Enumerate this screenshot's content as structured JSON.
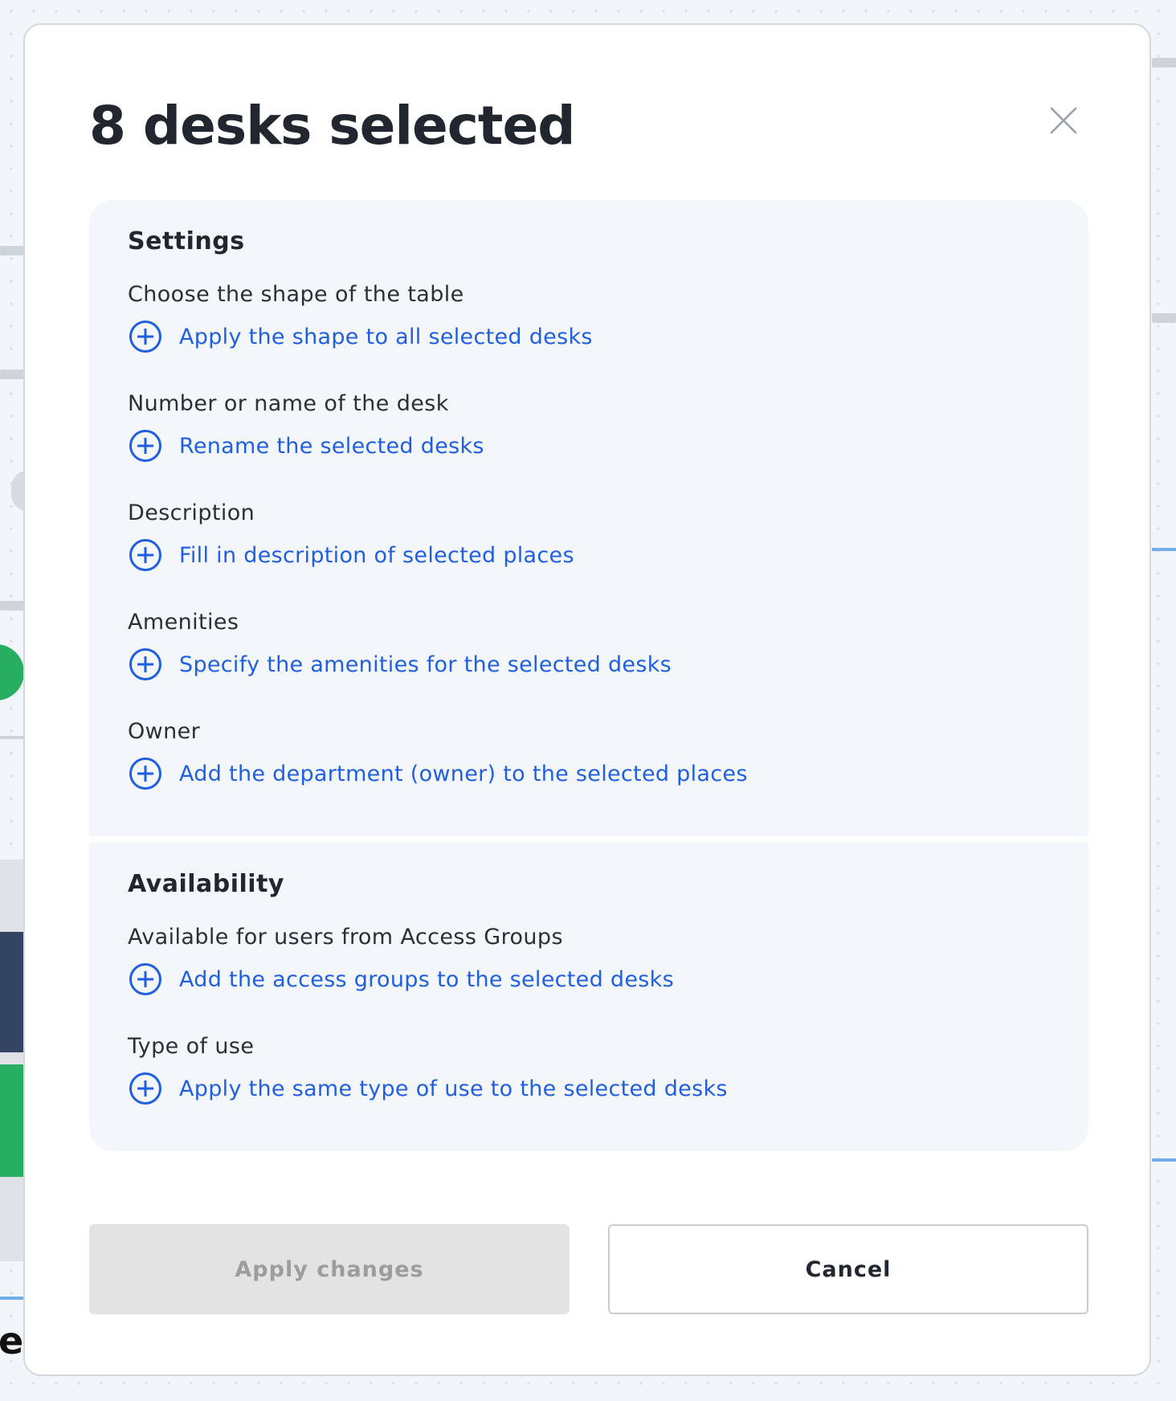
{
  "modal": {
    "title": "8 desks selected",
    "close_icon": "close-icon"
  },
  "settings": {
    "heading": "Settings",
    "fields": [
      {
        "label": "Choose the shape of the table",
        "action": "Apply the shape to all selected desks"
      },
      {
        "label": "Number or name of the desk",
        "action": "Rename the selected desks"
      },
      {
        "label": "Description",
        "action": "Fill in description of selected places"
      },
      {
        "label": "Amenities",
        "action": "Specify the amenities for the selected desks"
      },
      {
        "label": "Owner",
        "action": "Add the department (owner) to the selected places"
      }
    ]
  },
  "availability": {
    "heading": "Availability",
    "fields": [
      {
        "label": "Available for users from Access Groups",
        "action": "Add the access groups to the selected desks"
      },
      {
        "label": "Type of use",
        "action": "Apply the same type of use to the selected desks"
      }
    ]
  },
  "footer": {
    "apply_label": "Apply changes",
    "apply_disabled": true,
    "cancel_label": "Cancel"
  },
  "background": {
    "partial_letter": "e"
  },
  "colors": {
    "link": "#1f5fe0",
    "text": "#22262e",
    "panel_bg": "#f3f6fb",
    "disabled_bg": "#e3e3e3",
    "disabled_text": "#9d9d9d"
  },
  "icons": {
    "add": "plus-circle-icon",
    "close": "close-icon"
  }
}
